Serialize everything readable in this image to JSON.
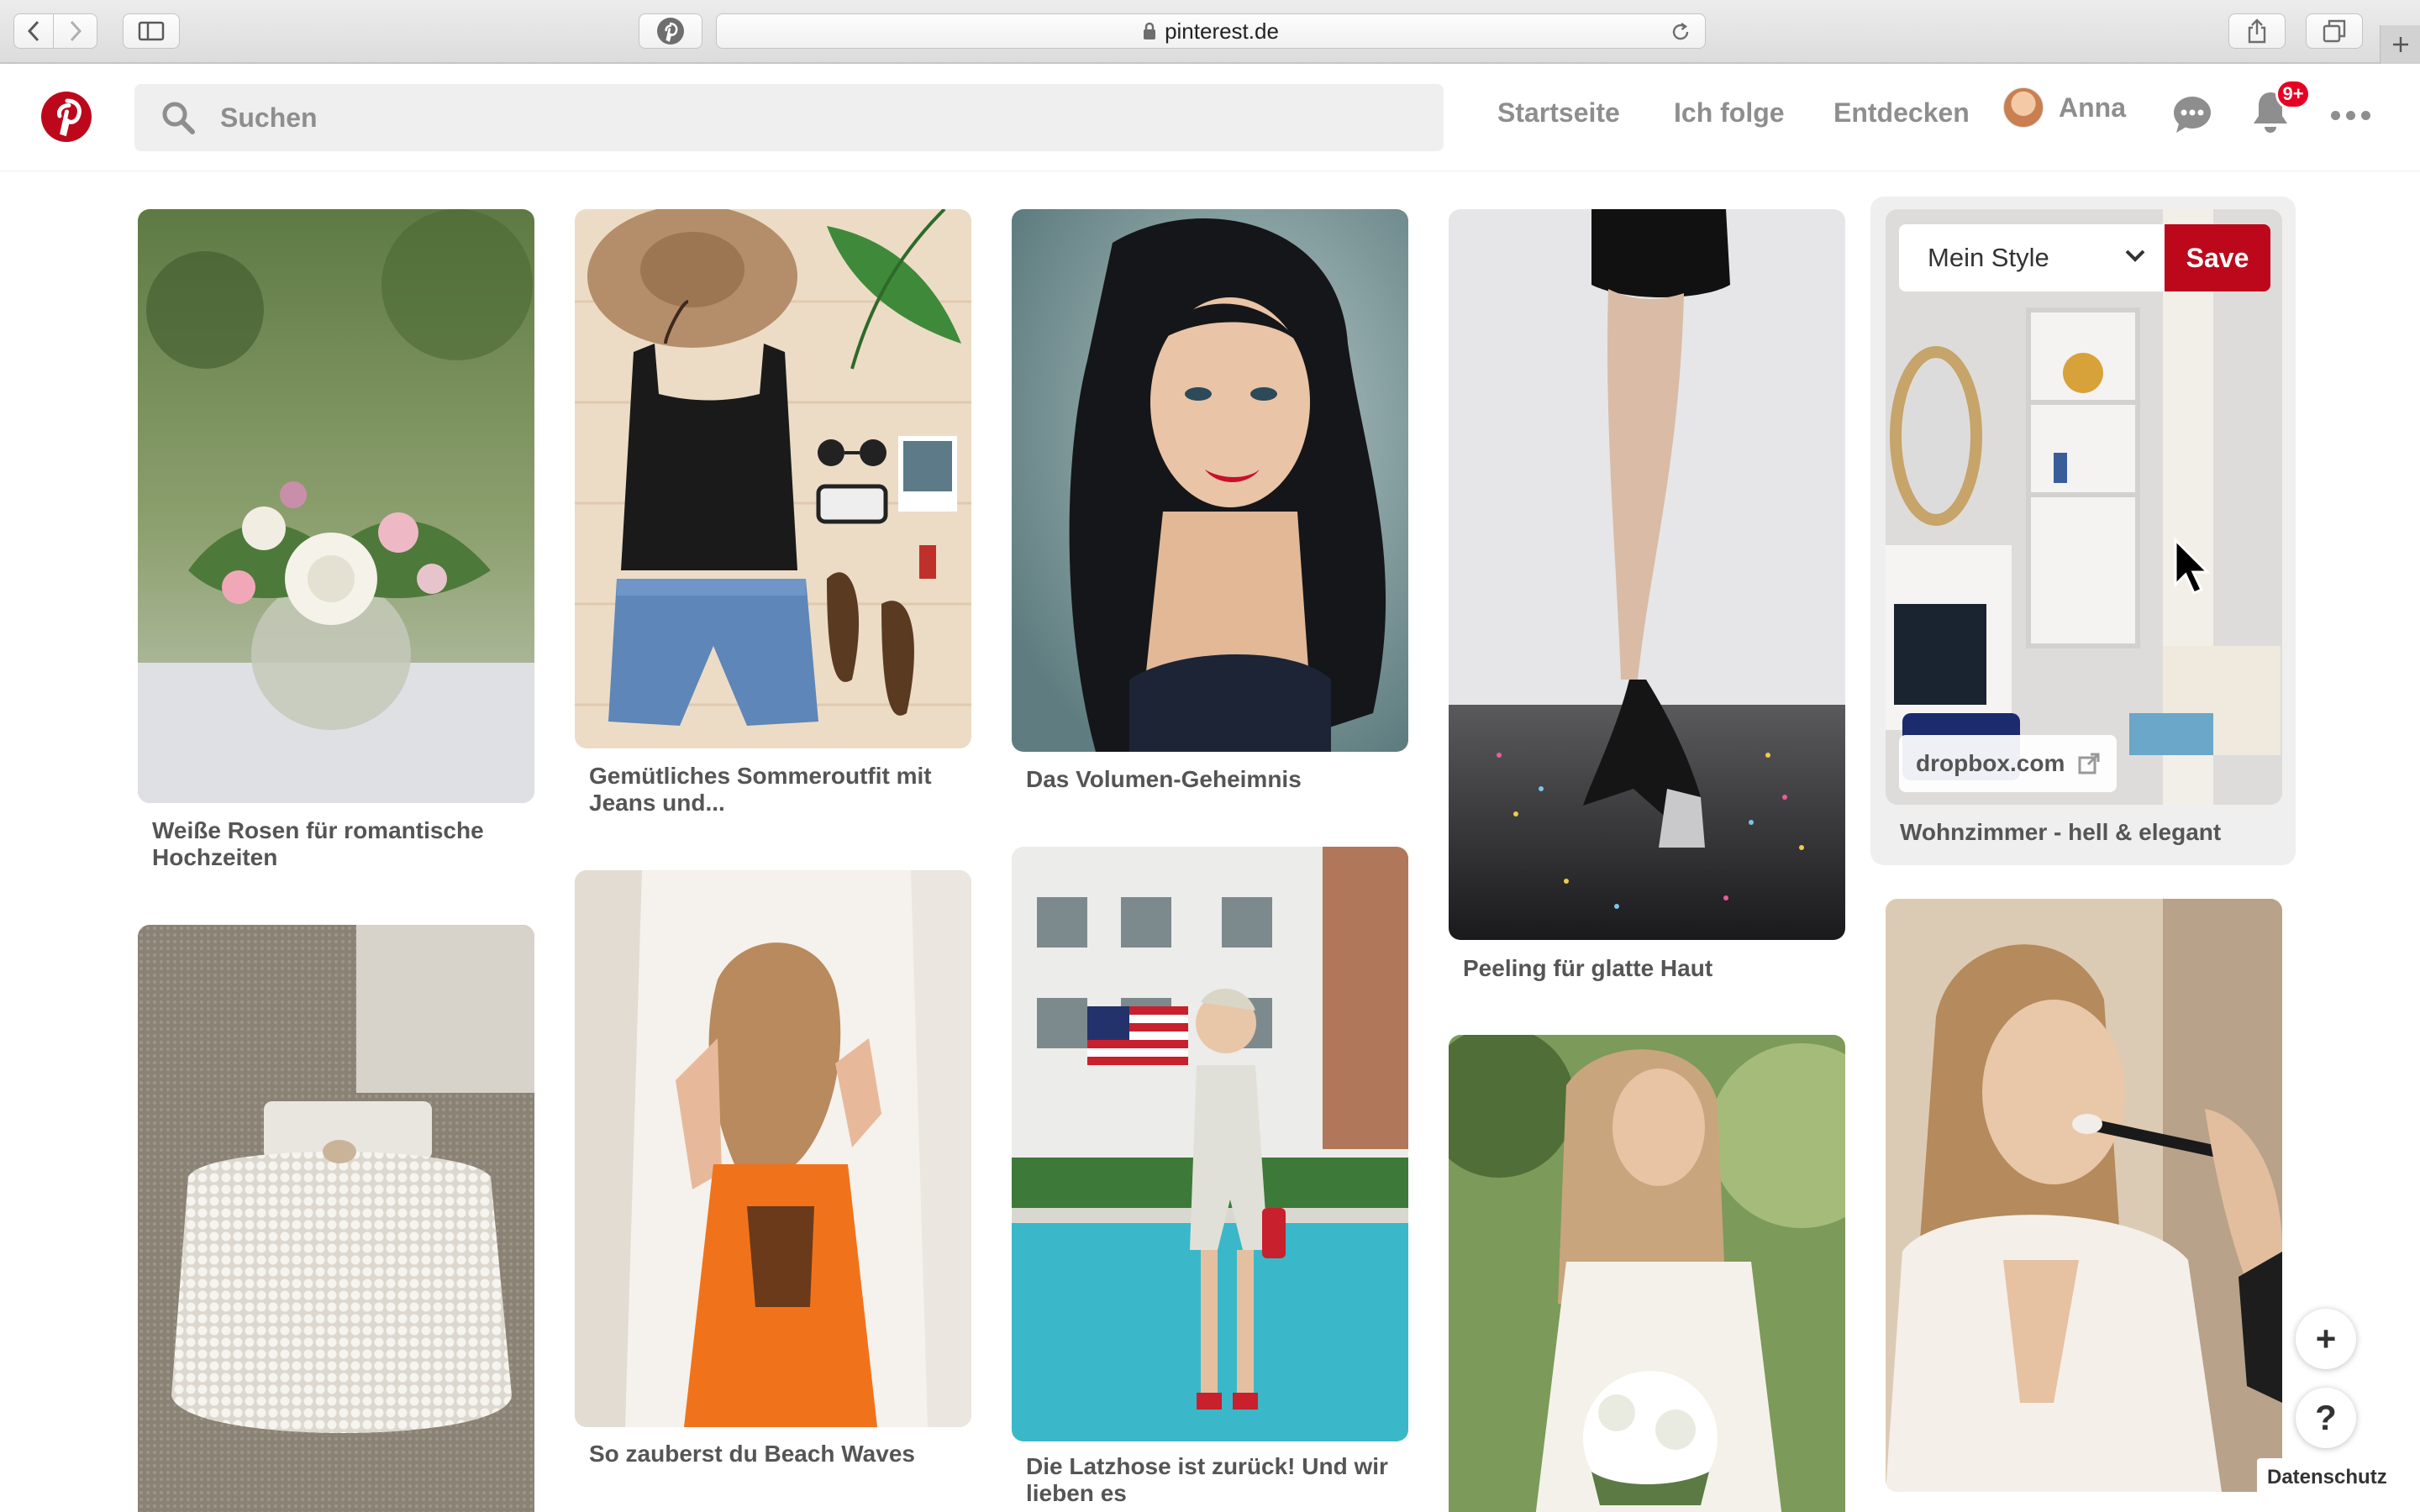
{
  "browser": {
    "url": "pinterest.de"
  },
  "header": {
    "search_placeholder": "Suchen",
    "nav_home": "Startseite",
    "nav_following": "Ich folge",
    "nav_explore": "Entdecken",
    "user_name": "Anna",
    "notification_badge": "9+",
    "brand_color": "#bd081c"
  },
  "pins": {
    "roses": {
      "title": "Weiße Rosen für romantische Hochzeiten"
    },
    "summer_outfit": {
      "title": "Gemütliches Sommeroutfit mit Jeans und..."
    },
    "volume": {
      "title": "Das Volumen-Geheimnis"
    },
    "peeling": {
      "title": "Peeling für glatte Haut"
    },
    "living_room": {
      "title": "Wohnzimmer - hell & elegant",
      "board_select": "Mein Style",
      "save_label": "Save",
      "domain": "dropbox.com"
    },
    "beach_waves": {
      "title": "So zauberst du Beach Waves"
    },
    "overalls": {
      "title": "Die Latzhose ist zurück! Und wir lieben es"
    }
  },
  "floating": {
    "add_symbol": "+",
    "help_symbol": "?",
    "privacy": "Datenschutz"
  }
}
